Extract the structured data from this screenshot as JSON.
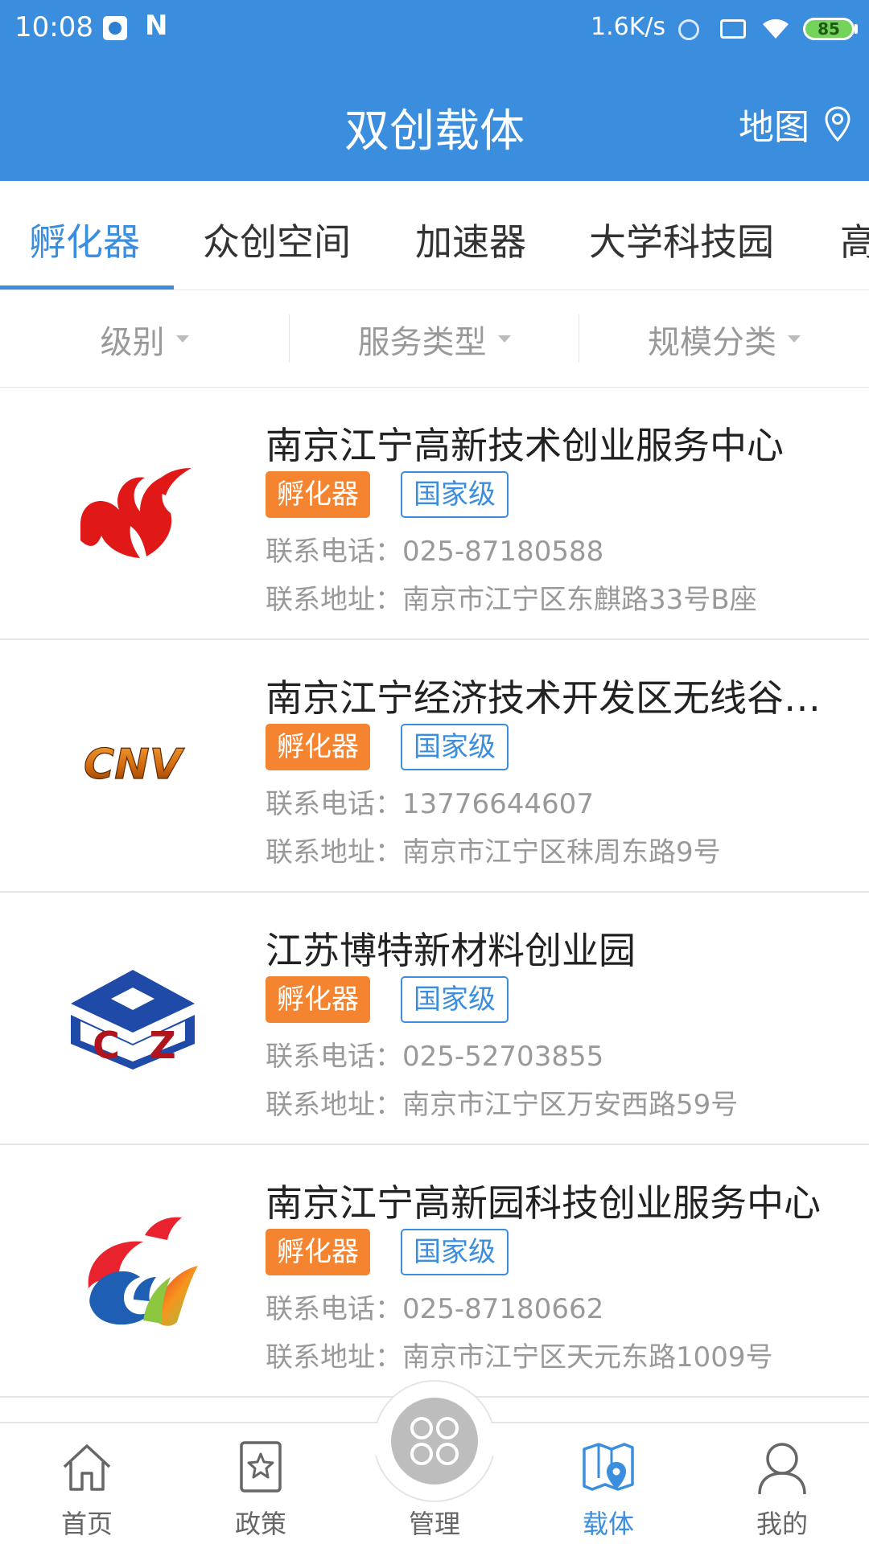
{
  "status_bar": {
    "time": "10:08",
    "net_speed": "1.6K/s",
    "battery": "85",
    "icons": [
      "app-icon",
      "n-icon",
      "hotspot-icon",
      "sim-icon",
      "wifi-icon",
      "battery-icon"
    ]
  },
  "header": {
    "title": "双创载体",
    "map_label": "地图",
    "map_icon": "location-pin-icon",
    "background": "#3b8ddd"
  },
  "tabs": [
    {
      "label": "孵化器",
      "active": true
    },
    {
      "label": "众创空间",
      "active": false
    },
    {
      "label": "加速器",
      "active": false
    },
    {
      "label": "大学科技园",
      "active": false
    },
    {
      "label": "高",
      "active": false
    }
  ],
  "filters": [
    {
      "label": "级别"
    },
    {
      "label": "服务类型"
    },
    {
      "label": "规模分类"
    }
  ],
  "listing": {
    "items": [
      {
        "name": "南京江宁高新技术创业服务中心",
        "type_tag": "孵化器",
        "level_tag": "国家级",
        "phone": "联系电话：025-87180588",
        "address": "联系地址：南京市江宁区东麒路33号B座",
        "logo": "torch-logo"
      },
      {
        "name": "南京江宁经济技术开发区无线谷…",
        "type_tag": "孵化器",
        "level_tag": "国家级",
        "phone": "联系电话：13776644607",
        "address": "联系地址：南京市江宁区秣周东路9号",
        "logo": "cnv-logo",
        "logo_text": "CNV"
      },
      {
        "name": "江苏博特新材料创业园",
        "type_tag": "孵化器",
        "level_tag": "国家级",
        "phone": "联系电话：025-52703855",
        "address": "联系地址：南京市江宁区万安西路59号",
        "logo": "cz-logo",
        "logo_text_c": "C",
        "logo_text_z": "Z"
      },
      {
        "name": "南京江宁高新园科技创业服务中心",
        "type_tag": "孵化器",
        "level_tag": "国家级",
        "phone": "联系电话：025-87180662",
        "address": "联系地址：南京市江宁区天元东路1009号",
        "logo": "phoenix-logo"
      }
    ]
  },
  "bottom_nav": [
    {
      "label": "首页",
      "icon": "home-icon",
      "active": false
    },
    {
      "label": "政策",
      "icon": "policy-star-icon",
      "active": false
    },
    {
      "label": "管理",
      "icon": "clover-icon",
      "active": false
    },
    {
      "label": "载体",
      "icon": "map-pin-icon",
      "active": true
    },
    {
      "label": "我的",
      "icon": "user-icon",
      "active": false
    }
  ],
  "colors": {
    "accent": "#3b8ddd",
    "tag_orange": "#f58431",
    "muted_text": "#999999"
  }
}
